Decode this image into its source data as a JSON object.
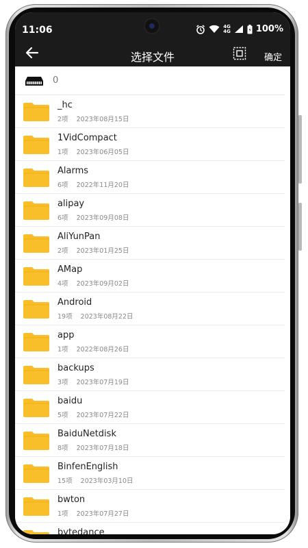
{
  "status": {
    "time": "11:06",
    "network_top": "4G",
    "network_bottom": "4G",
    "battery": "100%"
  },
  "appbar": {
    "title": "选择文件",
    "confirm_label": "确定"
  },
  "storage": {
    "label": "0"
  },
  "folders": [
    {
      "name": "_hc",
      "meta": "2项    2023年08月15日"
    },
    {
      "name": "1VidCompact",
      "meta": "1项    2023年06月05日"
    },
    {
      "name": "Alarms",
      "meta": "6项    2022年11月20日"
    },
    {
      "name": "alipay",
      "meta": "6项    2023年09月08日"
    },
    {
      "name": "AliYunPan",
      "meta": "2项    2023年01月25日"
    },
    {
      "name": "AMap",
      "meta": "4项    2023年09月02日"
    },
    {
      "name": "Android",
      "meta": "19项    2023年08月22日"
    },
    {
      "name": "app",
      "meta": "1项    2022年08月26日"
    },
    {
      "name": "backups",
      "meta": "3项    2023年07月19日"
    },
    {
      "name": "baidu",
      "meta": "5项    2023年07月22日"
    },
    {
      "name": "BaiduNetdisk",
      "meta": "8项    2023年07月18日"
    },
    {
      "name": "BinfenEnglish",
      "meta": "15项    2023年03月10日"
    },
    {
      "name": "bwton",
      "meta": "1项    2023年07月27日"
    },
    {
      "name": "bytedance",
      "meta": ""
    }
  ],
  "colors": {
    "bar": "#1b1b1b",
    "folder": "#F9BF2A"
  }
}
